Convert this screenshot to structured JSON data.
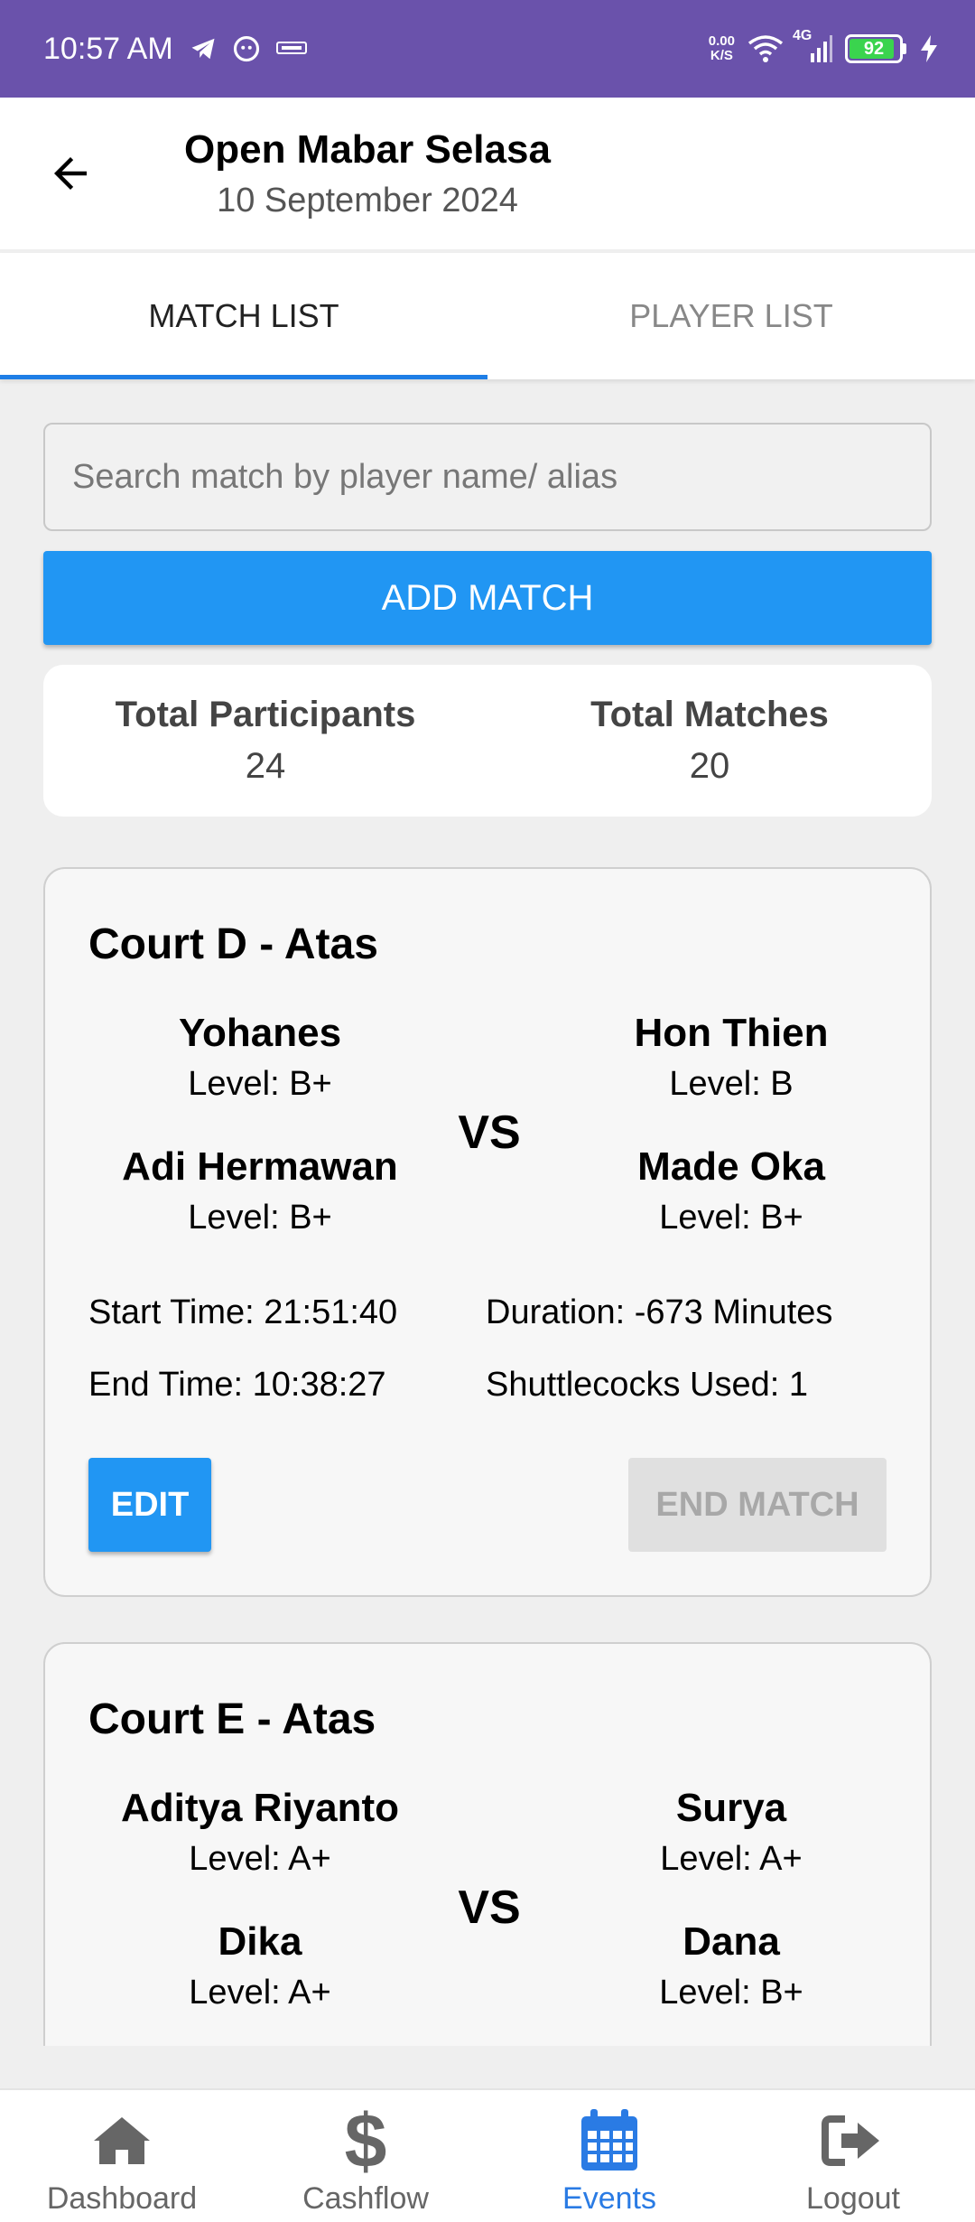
{
  "status_bar": {
    "time": "10:57 AM",
    "net_speed_value": "0.00",
    "net_speed_unit": "K/S",
    "network": "4G",
    "battery": "92",
    "battery_level_percent": 92,
    "icons": [
      "telegram-icon",
      "messenger-icon",
      "news-app-icon",
      "wifi-icon",
      "signal-icon",
      "battery-icon",
      "charging-icon"
    ]
  },
  "header": {
    "title": "Open Mabar Selasa",
    "date": "10 September 2024"
  },
  "tabs": [
    {
      "label": "MATCH LIST",
      "active": true
    },
    {
      "label": "PLAYER LIST",
      "active": false
    }
  ],
  "search": {
    "placeholder": "Search match by player name/ alias",
    "value": ""
  },
  "add_match_label": "ADD MATCH",
  "summary": {
    "participants_label": "Total Participants",
    "participants_value": "24",
    "matches_label": "Total Matches",
    "matches_value": "20"
  },
  "matches": [
    {
      "court": "Court D - Atas",
      "team_a": [
        {
          "name": "Yohanes",
          "level": "Level: B+"
        },
        {
          "name": "Adi Hermawan",
          "level": "Level: B+"
        }
      ],
      "team_b": [
        {
          "name": "Hon Thien",
          "level": "Level: B"
        },
        {
          "name": "Made Oka",
          "level": "Level: B+"
        }
      ],
      "vs": "VS",
      "start_time": "Start Time: 21:51:40",
      "end_time": "End Time: 10:38:27",
      "duration": "Duration: -673 Minutes",
      "shuttlecocks": "Shuttlecocks Used: 1",
      "edit_label": "EDIT",
      "end_label": "END MATCH"
    },
    {
      "court": "Court E - Atas",
      "team_a": [
        {
          "name": "Aditya Riyanto",
          "level": "Level: A+"
        },
        {
          "name": "Dika",
          "level": "Level: A+"
        }
      ],
      "team_b": [
        {
          "name": "Surya",
          "level": "Level: A+"
        },
        {
          "name": "Dana",
          "level": "Level: B+"
        }
      ],
      "vs": "VS"
    }
  ],
  "bottom_nav": [
    {
      "label": "Dashboard",
      "icon": "home-icon",
      "active": false
    },
    {
      "label": "Cashflow",
      "icon": "dollar-icon",
      "active": false
    },
    {
      "label": "Events",
      "icon": "calendar-icon",
      "active": true
    },
    {
      "label": "Logout",
      "icon": "logout-icon",
      "active": false
    }
  ],
  "colors": {
    "status_bar": "#6a52ab",
    "primary": "#2196f3",
    "tab_indicator": "#1e7ee6",
    "nav_active": "#2a7be4",
    "battery_fill": "#3ad44e"
  }
}
